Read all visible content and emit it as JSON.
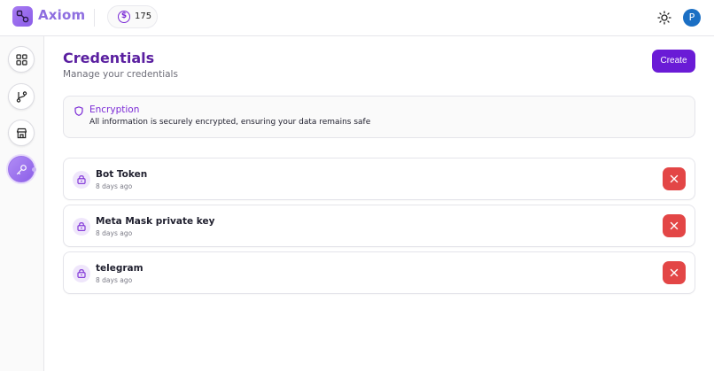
{
  "header": {
    "brand": "Axiom",
    "credits": "175",
    "avatar_initial": "P"
  },
  "sidebar": {
    "items": [
      {
        "name": "dashboard",
        "icon": "grid-icon"
      },
      {
        "name": "workflows",
        "icon": "git-branch-icon"
      },
      {
        "name": "marketplace",
        "icon": "store-icon"
      },
      {
        "name": "credentials",
        "icon": "key-icon",
        "active": true
      }
    ]
  },
  "page": {
    "title": "Credentials",
    "subtitle": "Manage your credentials",
    "create_label": "Create"
  },
  "info": {
    "title": "Encryption",
    "text": "All information is securely encrypted, ensuring your data remains safe"
  },
  "credentials": [
    {
      "name": "Bot Token",
      "time": "8 days ago"
    },
    {
      "name": "Meta Mask private key",
      "time": "8 days ago"
    },
    {
      "name": "telegram",
      "time": "8 days ago"
    }
  ],
  "colors": {
    "accent": "#6a1bd6",
    "danger": "#e34646",
    "title": "#5a1fa0"
  }
}
